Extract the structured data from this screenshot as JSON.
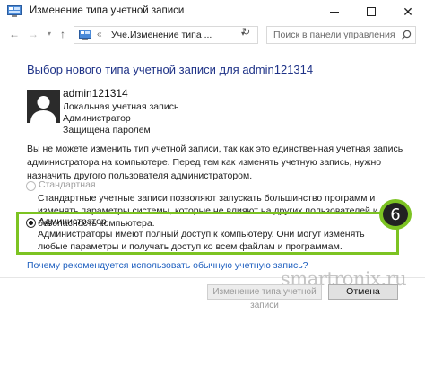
{
  "window": {
    "title": "Изменение типа учетной записи",
    "minimize": "—",
    "maximize": "",
    "close": "✕"
  },
  "nav": {
    "back": "←",
    "forward": "→",
    "recent": "▾",
    "up": "↑",
    "breadcrumb": [
      "«",
      "Уче...",
      "›",
      "Изменение типа ..."
    ],
    "address_dropdown": "▾",
    "refresh": "↻",
    "search_placeholder": "Поиск в панели управления"
  },
  "content": {
    "heading": "Выбор нового типа учетной записи для admin121314",
    "account": {
      "name": "admin121314",
      "lines": [
        "Локальная учетная запись",
        "Администратор",
        "Защищена паролем"
      ]
    },
    "notice": "Вы не можете изменить тип учетной записи, так как это единственная учетная запись администратора на компьютере. Перед тем как изменять учетную запись, нужно назначить другого пользователя администратором.",
    "options": {
      "standard": {
        "label": "Стандартная",
        "description": "Стандартные учетные записи позволяют запускать большинство программ и изменять параметры системы, которые не влияют на других пользователей и безопасность компьютера.",
        "selected": false,
        "enabled": false
      },
      "admin": {
        "label": "Администратор",
        "description": "Администраторы имеют полный доступ к компьютеру. Они могут изменять любые параметры и получать доступ ко всем файлам и программам.",
        "selected": true,
        "enabled": true
      }
    },
    "step_badge": "6",
    "help_link": "Почему рекомендуется использовать обычную учетную запись?"
  },
  "buttons": {
    "change": "Изменение типа учетной записи",
    "cancel": "Отмена"
  },
  "watermark": "smartronix.ru",
  "colors": {
    "heading": "#1e3287",
    "link": "#1d5fbf",
    "highlight": "#7cc322"
  }
}
